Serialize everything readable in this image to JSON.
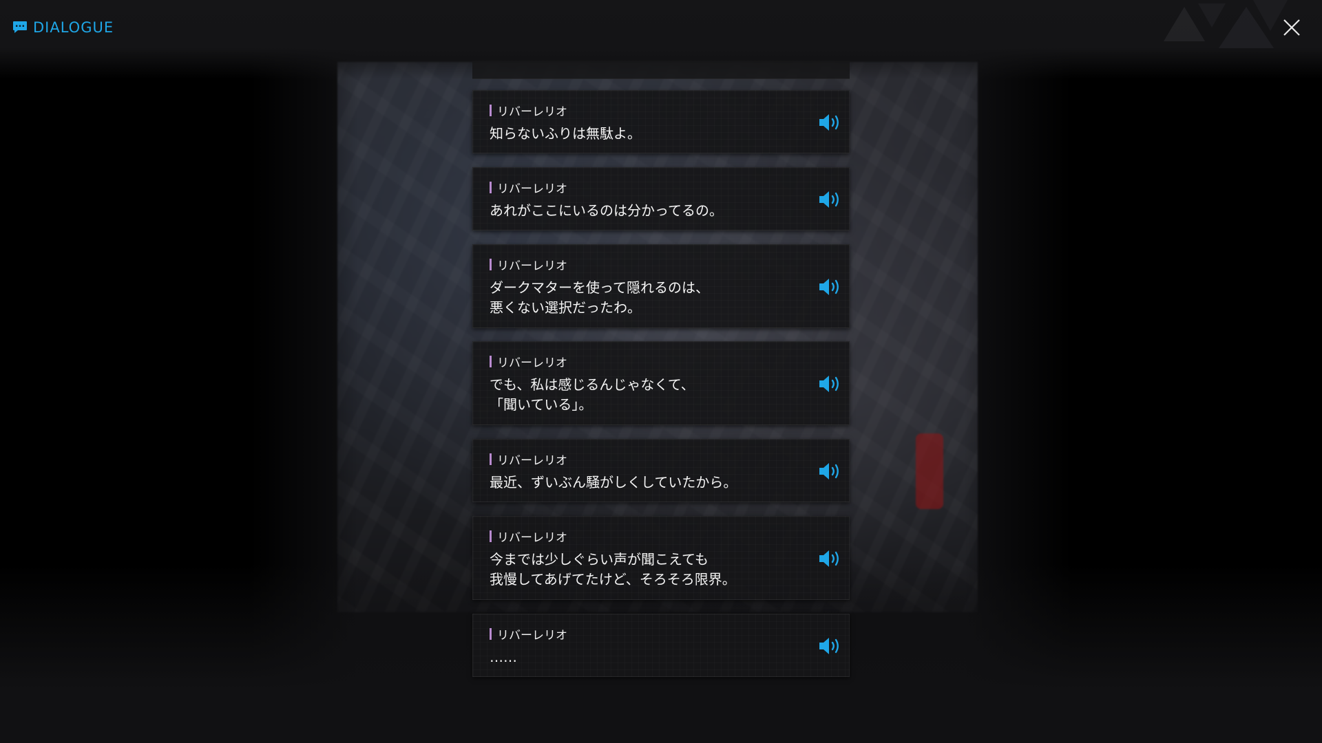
{
  "header": {
    "title": "DIALOGUE",
    "title_icon": "chat-bubble-icon",
    "close_icon": "close-icon"
  },
  "colors": {
    "accent": "#1fa7e8",
    "speaker_bar": "#b98bd0",
    "card_bg": "#161618"
  },
  "dialogue": [
    {
      "speaker": "リバーレリオ",
      "lines": [
        "知らないふりは無駄よ。"
      ]
    },
    {
      "speaker": "リバーレリオ",
      "lines": [
        "あれがここにいるのは分かってるの。"
      ]
    },
    {
      "speaker": "リバーレリオ",
      "lines": [
        "ダークマターを使って隠れるのは、",
        "悪くない選択だったわ。"
      ]
    },
    {
      "speaker": "リバーレリオ",
      "lines": [
        "でも、私は感じるんじゃなくて、",
        "「聞いている」。"
      ]
    },
    {
      "speaker": "リバーレリオ",
      "lines": [
        "最近、ずいぶん騒がしくしていたから。"
      ]
    },
    {
      "speaker": "リバーレリオ",
      "lines": [
        "今までは少しぐらい声が聞こえても",
        "我慢してあげてたけど、そろそろ限界。"
      ]
    },
    {
      "speaker": "リバーレリオ",
      "lines": [
        "……"
      ]
    }
  ]
}
